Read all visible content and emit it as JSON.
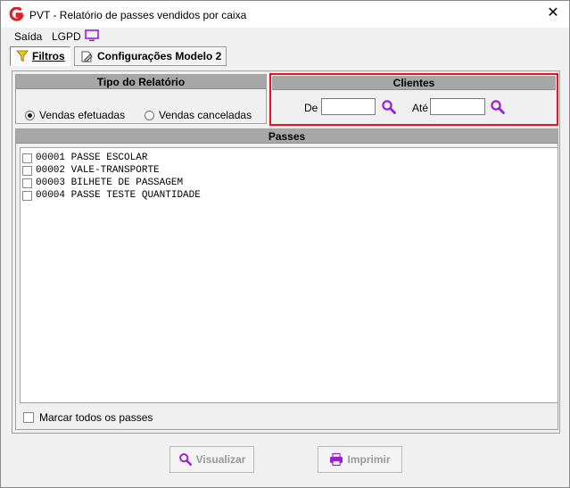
{
  "window": {
    "title": "PVT - Relatório de passes vendidos por caixa",
    "close_glyph": "✕"
  },
  "menu": {
    "items": [
      "Saída",
      "LGPD"
    ],
    "lgpd_icon": "monitor-icon"
  },
  "toolbar": {
    "tabs": [
      {
        "label": "Filtros",
        "icon": "filter-icon",
        "active": true
      },
      {
        "label": "Configurações Modelo 2",
        "icon": "edit-document-icon",
        "active": false
      }
    ]
  },
  "report_type": {
    "title": "Tipo do Relatório",
    "options": [
      {
        "label": "Vendas efetuadas",
        "checked": true
      },
      {
        "label": "Vendas canceladas",
        "checked": false
      }
    ]
  },
  "clients": {
    "title": "Clientes",
    "from_label": "De",
    "from_value": "",
    "to_label": "Até",
    "to_value": "",
    "highlight_color": "#e81123"
  },
  "passes": {
    "title": "Passes",
    "items": [
      {
        "code": "00001",
        "name": "PASSE ESCOLAR",
        "checked": false
      },
      {
        "code": "00002",
        "name": "VALE-TRANSPORTE",
        "checked": false
      },
      {
        "code": "00003",
        "name": "BILHETE DE PASSAGEM",
        "checked": false
      },
      {
        "code": "00004",
        "name": "PASSE TESTE QUANTIDADE",
        "checked": false
      }
    ],
    "select_all_label": "Marcar todos os passes",
    "select_all_checked": false
  },
  "actions": {
    "view_label": "Visualizar",
    "print_label": "Imprimir",
    "enabled": false
  },
  "colors": {
    "accent_purple": "#9b1fd0",
    "header_gray": "#a7a7a7"
  }
}
